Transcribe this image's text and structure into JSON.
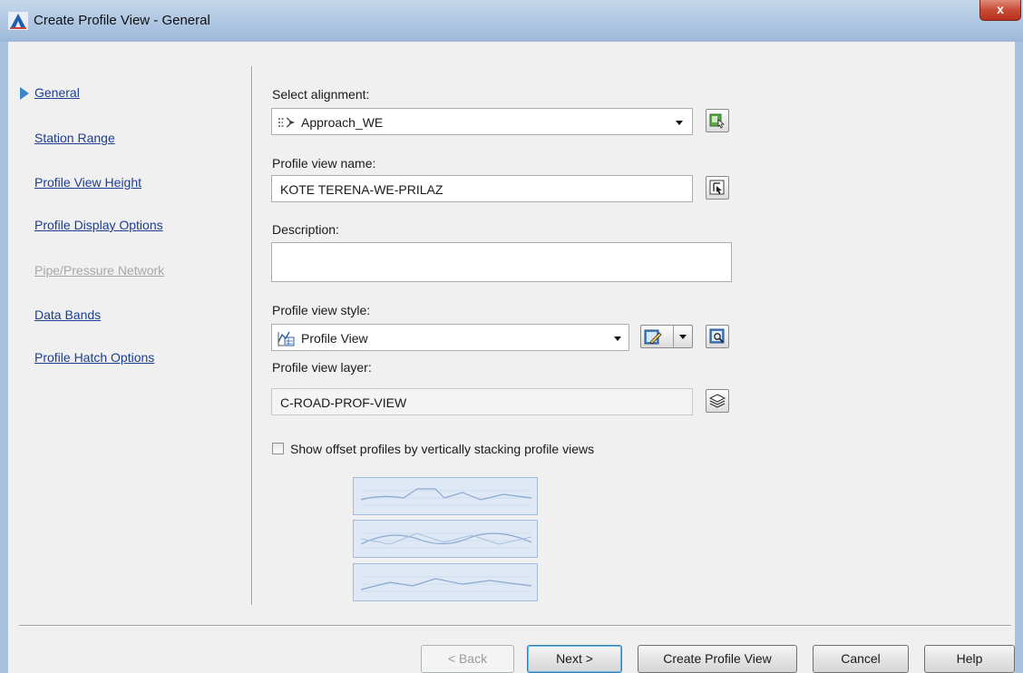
{
  "window": {
    "title": "Create Profile View - General",
    "close_label": "x"
  },
  "nav": {
    "items": [
      {
        "label": "General",
        "active": true,
        "enabled": true
      },
      {
        "label": "Station Range",
        "enabled": true
      },
      {
        "label": "Profile View Height",
        "enabled": true
      },
      {
        "label": "Profile Display Options",
        "enabled": true
      },
      {
        "label": "Pipe/Pressure Network",
        "enabled": false
      },
      {
        "label": "Data Bands",
        "enabled": true
      },
      {
        "label": "Profile Hatch Options",
        "enabled": true
      }
    ]
  },
  "form": {
    "alignment": {
      "label": "Select alignment:",
      "value": "Approach_WE",
      "icon": "alignment-icon"
    },
    "view_name": {
      "label": "Profile view name:",
      "value": "KOTE TERENA-WE-PRILAZ"
    },
    "description": {
      "label": "Description:",
      "value": ""
    },
    "style": {
      "label": "Profile view style:",
      "value": "Profile View",
      "icon": "profile-view-style-icon"
    },
    "layer": {
      "label": "Profile view layer:",
      "value": "C-ROAD-PROF-VIEW"
    },
    "stack": {
      "label": "Show offset profiles by vertically stacking profile views",
      "checked": false
    }
  },
  "buttons": {
    "back": "< Back",
    "next": "Next >",
    "create": "Create Profile View",
    "cancel": "Cancel",
    "help": "Help"
  },
  "colors": {
    "link": "#1b3e93",
    "disabled": "#a8a8a8",
    "accent": "#3a86c8",
    "titlebar": "#aec6e2",
    "close": "#c74b36"
  }
}
